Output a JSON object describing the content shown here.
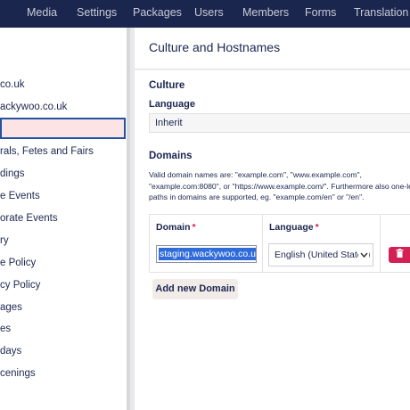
{
  "topnav": [
    "Media",
    "Settings",
    "Packages",
    "Users",
    "Members",
    "Forms",
    "Translation"
  ],
  "sidebar": {
    "items": [
      "co.uk",
      "ackywoo.co.uk",
      "",
      "rals, Fetes and Fairs",
      "dings",
      "e Events",
      "orate Events",
      "ry",
      "e Policy",
      "cy Policy",
      "ages",
      "es",
      "days",
      "cenings"
    ]
  },
  "panel": {
    "title": "Culture and Hostnames",
    "culture": {
      "heading": "Culture",
      "language_label": "Language",
      "language_value": "Inherit"
    },
    "domains": {
      "heading": "Domains",
      "help_lines": [
        "Valid domain names are: \"example.com\", \"www.example.com\",",
        "\"example.com:8080\", or \"https://www.example.com/\". Furthermore also one-le",
        "paths in domains are supported, eg. \"example.com/en\" or \"/en\"."
      ],
      "col_domain": "Domain",
      "col_language": "Language",
      "required_mark": "*",
      "rows": [
        {
          "domain": "staging.wackywoo.co.uk",
          "language": "English (United States)"
        }
      ],
      "add_button": "Add new Domain"
    }
  },
  "colors": {
    "nav_bg": "#1b264f",
    "danger": "#d42054",
    "selected_bg": "#fde4e4",
    "selection_blue": "#2f6bd9"
  }
}
